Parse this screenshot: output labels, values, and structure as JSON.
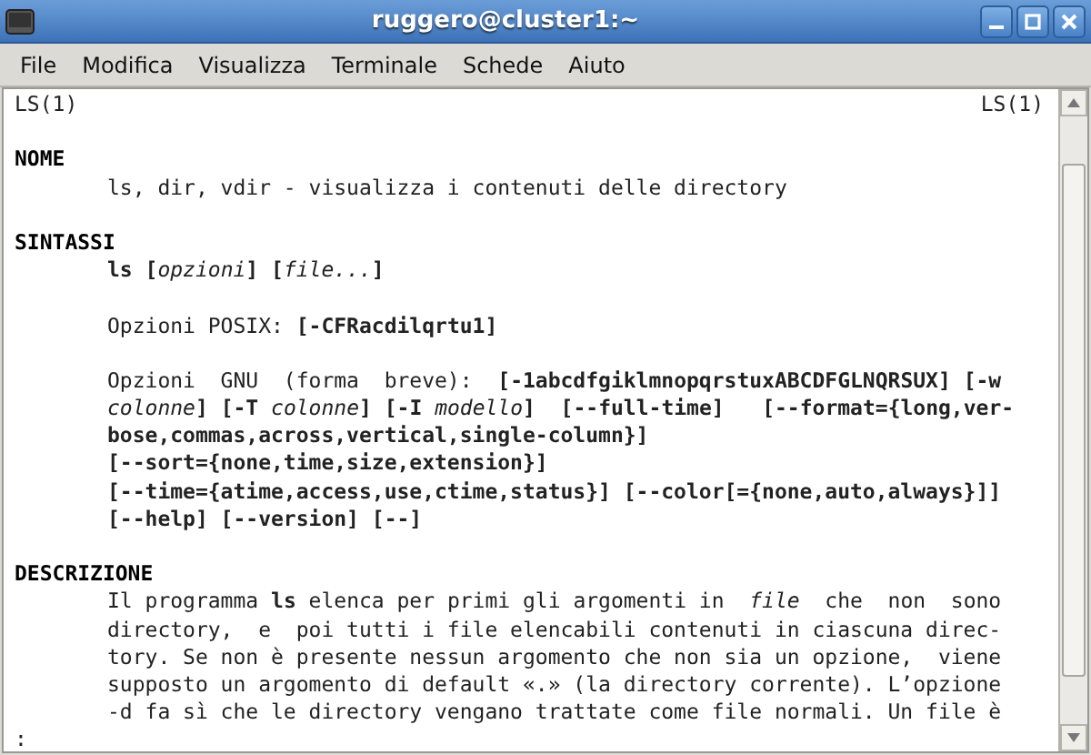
{
  "window": {
    "title": "ruggero@cluster1:~"
  },
  "menu": [
    "File",
    "Modifica",
    "Visualizza",
    "Terminale",
    "Schede",
    "Aiuto"
  ],
  "terminal": {
    "lines": [
      {
        "kind": "header",
        "left": "LS(1)",
        "right": "LS(1)"
      },
      {
        "kind": "blank"
      },
      {
        "kind": "heading",
        "text": "NOME"
      },
      {
        "kind": "body",
        "text": "ls, dir, vdir - visualizza i contenuti delle directory"
      },
      {
        "kind": "blank"
      },
      {
        "kind": "heading",
        "text": "SINTASSI"
      },
      {
        "kind": "body",
        "parts": [
          "**ls [**",
          "*opzioni*",
          "**] [**",
          "*file...*",
          "**]**"
        ]
      },
      {
        "kind": "blank"
      },
      {
        "kind": "body",
        "text": "Opzioni POSIX: **[-CFRacdilqrtu1]**"
      },
      {
        "kind": "blank"
      },
      {
        "kind": "body",
        "text": "Opzioni  GNU  (forma  breve):  **[-1abcdfgiklmnopqrstuxABCDFGLNQRSUX] [-w**"
      },
      {
        "kind": "body",
        "parts": [
          "*colonne*",
          "**] [-T** ",
          "*colonne*",
          "**] [-I** ",
          "*modello*",
          "**]  [--full-time]   [--format={long,ver-**"
        ]
      },
      {
        "kind": "body",
        "text": "**bose,commas,across,vertical,single-column}]**"
      },
      {
        "kind": "body",
        "text": "**[--sort={none,time,size,extension}]**"
      },
      {
        "kind": "body",
        "text": "**[--time={atime,access,use,ctime,status}] [--color[={none,auto,always}]]**"
      },
      {
        "kind": "body",
        "text": "**[--help] [--version] [--]**"
      },
      {
        "kind": "blank"
      },
      {
        "kind": "heading",
        "text": "DESCRIZIONE"
      },
      {
        "kind": "body",
        "parts": [
          "Il programma **ls** elenca per primi gli argomenti in  ",
          "*file*",
          "  che  non  sono"
        ]
      },
      {
        "kind": "body",
        "text": "directory,  e  poi tutti i file elencabili contenuti in ciascuna direc-"
      },
      {
        "kind": "body",
        "text": "tory. Se non è presente nessun argomento che non sia un opzione,  viene"
      },
      {
        "kind": "body",
        "text": "supposto un argomento di default «.» (la directory corrente). L’opzione"
      },
      {
        "kind": "body",
        "text": "-d fa sì che le directory vengano trattate come file normali. Un file è"
      },
      {
        "kind": "prompt",
        "text": ":"
      }
    ]
  }
}
